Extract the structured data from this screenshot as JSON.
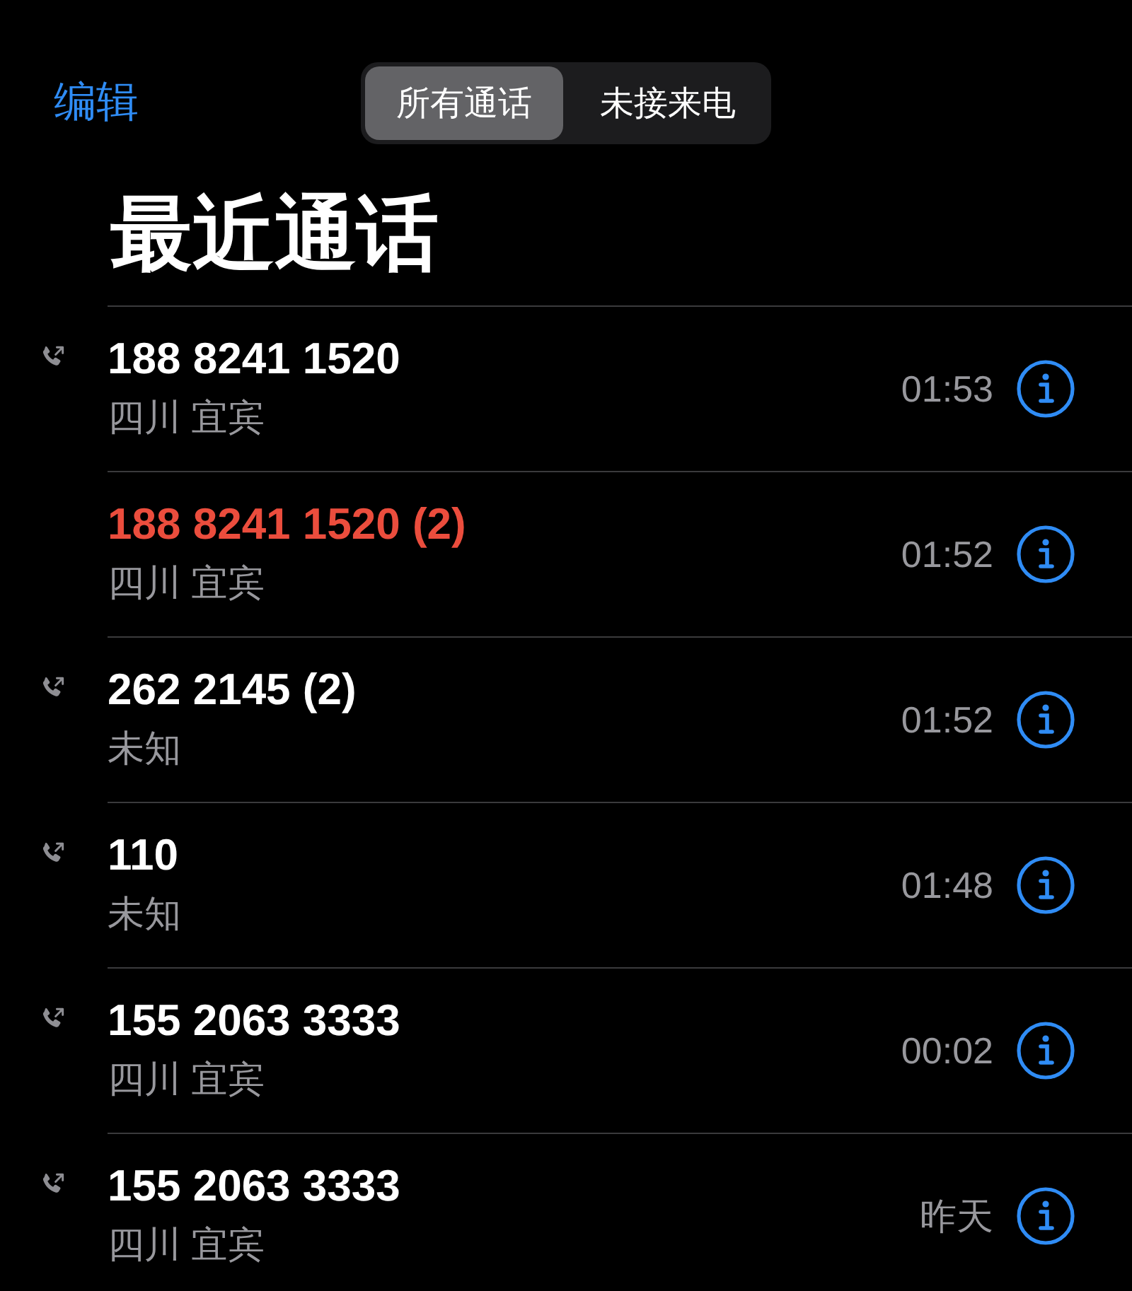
{
  "nav": {
    "edit": "编辑",
    "segments": [
      {
        "label": "所有通话",
        "selected": true
      },
      {
        "label": "未接来电",
        "selected": false
      }
    ]
  },
  "title": "最近通话",
  "calls": [
    {
      "kind": "outgoing",
      "number": "188 8241 1520",
      "location": "四川 宜宾",
      "time": "01:53"
    },
    {
      "kind": "missed",
      "number": "188 8241 1520 (2)",
      "location": "四川 宜宾",
      "time": "01:52"
    },
    {
      "kind": "outgoing",
      "number": "262 2145 (2)",
      "location": "未知",
      "time": "01:52"
    },
    {
      "kind": "outgoing",
      "number": "110",
      "location": "未知",
      "time": "01:48"
    },
    {
      "kind": "outgoing",
      "number": "155 2063 3333",
      "location": "四川 宜宾",
      "time": "00:02"
    },
    {
      "kind": "outgoing",
      "number": "155 2063 3333",
      "location": "四川 宜宾",
      "time": "昨天"
    }
  ]
}
